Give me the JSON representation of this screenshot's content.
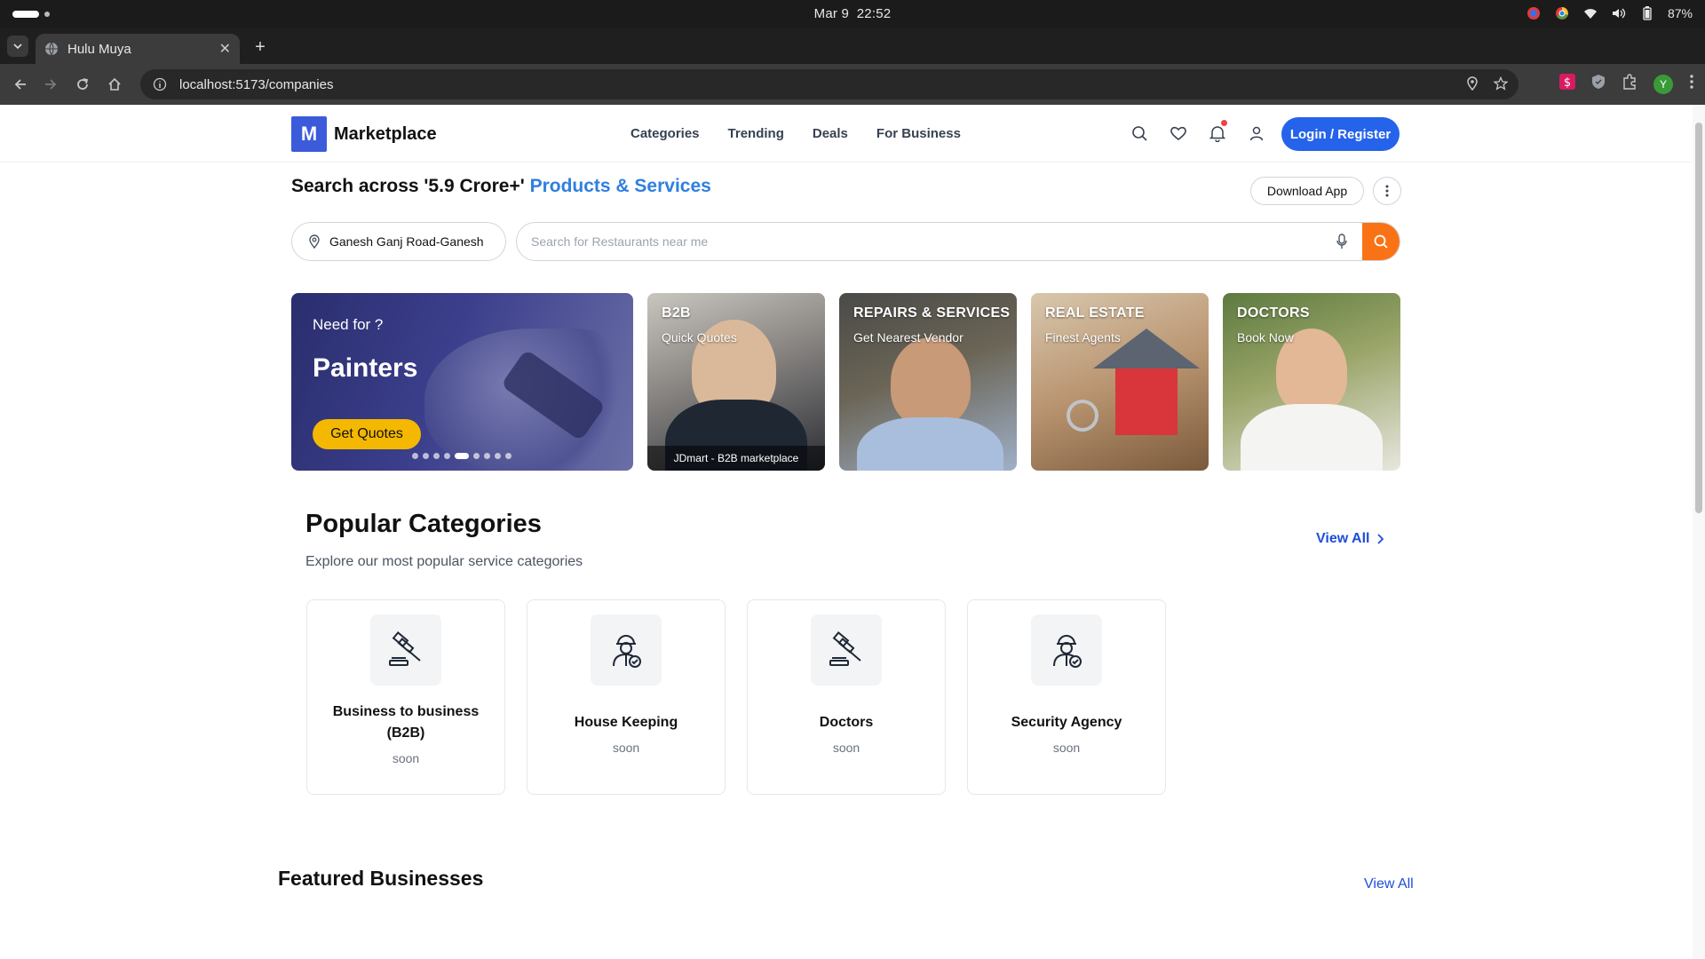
{
  "os": {
    "date": "Mar 9",
    "time": "22:52",
    "battery": "87%"
  },
  "browser": {
    "tab_title": "Hulu Muya",
    "url": "localhost:5173/companies",
    "profile_initial": "Y"
  },
  "site": {
    "logo_letter": "M",
    "logo_text": "Marketplace",
    "nav": [
      "Categories",
      "Trending",
      "Deals",
      "For Business"
    ],
    "login_label": "Login / Register"
  },
  "hero": {
    "headline_prefix": "Search across '5.9 Crore+' ",
    "headline_highlight": "Products & Services",
    "download_label": "Download App",
    "location_value": "Ganesh Ganj Road-Ganesh",
    "search_placeholder": "Search for Restaurants near me"
  },
  "banner": {
    "kicker": "Need for ?",
    "title": "Painters",
    "cta": "Get Quotes",
    "dot_count": 9,
    "active_dot": 5
  },
  "tiles": [
    {
      "title": "B2B",
      "subtitle": "Quick Quotes",
      "caption": "JDmart - B2B marketplace"
    },
    {
      "title": "REPAIRS & SERVICES",
      "subtitle": "Get Nearest Vendor"
    },
    {
      "title": "REAL ESTATE",
      "subtitle": "Finest Agents"
    },
    {
      "title": "DOCTORS",
      "subtitle": "Book Now"
    }
  ],
  "popular": {
    "title": "Popular Categories",
    "subtitle": "Explore our most popular service categories",
    "view_all": "View All",
    "categories": [
      {
        "name_line1": "Business to business",
        "name_line2": "(B2B)",
        "status": "soon",
        "icon": "gavel-icon"
      },
      {
        "name": "House Keeping",
        "status": "soon",
        "icon": "worker-icon"
      },
      {
        "name": "Doctors",
        "status": "soon",
        "icon": "gavel-icon"
      },
      {
        "name": "Security Agency",
        "status": "soon",
        "icon": "worker-icon"
      }
    ]
  },
  "featured": {
    "title": "Featured Businesses",
    "view_all": "View All"
  },
  "colors": {
    "primary": "#2563eb",
    "accent_orange": "#f97316",
    "cta_yellow": "#f5b800",
    "link_blue": "#1d4ed8",
    "headline_blue": "#2f7fe0"
  }
}
